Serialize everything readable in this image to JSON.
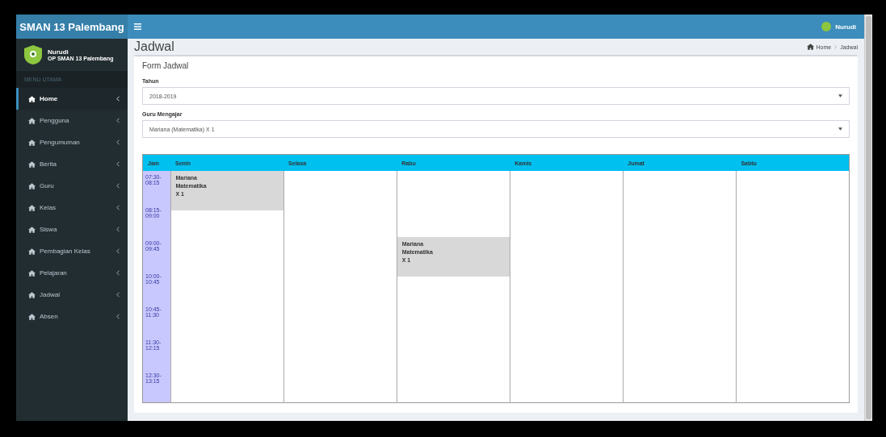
{
  "brand": "SMAN 13 Palembang",
  "header_user": {
    "name": "Nurudi"
  },
  "user_panel": {
    "name": "Nurudi",
    "role": "OP SMAN 13 Palembang"
  },
  "nav_label": "MENU UTAMA",
  "menu": [
    {
      "label": "Home",
      "selected": true
    },
    {
      "label": "Pengguna",
      "selected": false
    },
    {
      "label": "Pengumuman",
      "selected": false
    },
    {
      "label": "Berita",
      "selected": false
    },
    {
      "label": "Guru",
      "selected": false
    },
    {
      "label": "Kelas",
      "selected": false
    },
    {
      "label": "Siswa",
      "selected": false
    },
    {
      "label": "Pembagian Kelas",
      "selected": false
    },
    {
      "label": "Pelajaran",
      "selected": false
    },
    {
      "label": "Jadwal",
      "selected": false
    },
    {
      "label": "Absen",
      "selected": false
    }
  ],
  "page": {
    "title": "Jadwal",
    "breadcrumb": [
      "Home",
      "Jadwal"
    ]
  },
  "form": {
    "title": "Form Jadwal",
    "fields": [
      {
        "label": "Tahun",
        "value": "2018-2019"
      },
      {
        "label": "Guru Mengajar",
        "value": "Mariana (Matematika) X 1"
      }
    ]
  },
  "schedule": {
    "columns": [
      "Jam",
      "Senin",
      "Selasa",
      "Rabu",
      "Kamis",
      "Jumat",
      "Sabtu"
    ],
    "rows": [
      {
        "cells": [
          {
            "kind": "time",
            "lines": [
              "07:30-",
              "08:15"
            ]
          },
          {
            "kind": "lesson",
            "lines": [
              "Mariana",
              "Matematika",
              "X 1"
            ]
          },
          {
            "kind": "empty"
          },
          {
            "kind": "empty"
          },
          {
            "kind": "empty"
          },
          {
            "kind": "empty"
          },
          {
            "kind": "empty"
          }
        ]
      },
      {
        "cells": [
          {
            "kind": "time",
            "lines": [
              "08:15-",
              "09:00"
            ]
          },
          {
            "kind": "empty"
          },
          {
            "kind": "empty"
          },
          {
            "kind": "empty"
          },
          {
            "kind": "empty"
          },
          {
            "kind": "empty"
          },
          {
            "kind": "empty"
          }
        ]
      },
      {
        "cells": [
          {
            "kind": "time",
            "lines": [
              "09:00-",
              "09:45"
            ]
          },
          {
            "kind": "empty"
          },
          {
            "kind": "empty"
          },
          {
            "kind": "lesson",
            "lines": [
              "Mariana",
              "Matematika",
              "X 1"
            ]
          },
          {
            "kind": "empty"
          },
          {
            "kind": "empty"
          },
          {
            "kind": "empty"
          }
        ]
      },
      {
        "cells": [
          {
            "kind": "time",
            "lines": [
              "10:00-",
              "10:45"
            ]
          },
          {
            "kind": "empty"
          },
          {
            "kind": "empty"
          },
          {
            "kind": "empty"
          },
          {
            "kind": "empty"
          },
          {
            "kind": "empty"
          },
          {
            "kind": "empty"
          }
        ]
      },
      {
        "cells": [
          {
            "kind": "time",
            "lines": [
              "10:45-",
              "11:30"
            ]
          },
          {
            "kind": "empty"
          },
          {
            "kind": "empty"
          },
          {
            "kind": "empty"
          },
          {
            "kind": "empty"
          },
          {
            "kind": "empty"
          },
          {
            "kind": "empty"
          }
        ]
      },
      {
        "cells": [
          {
            "kind": "time",
            "lines": [
              "11:30-",
              "12:15"
            ]
          },
          {
            "kind": "empty"
          },
          {
            "kind": "empty"
          },
          {
            "kind": "empty"
          },
          {
            "kind": "empty"
          },
          {
            "kind": "empty"
          },
          {
            "kind": "empty"
          }
        ]
      },
      {
        "cells": [
          {
            "kind": "time",
            "lines": [
              "12:30-",
              "13:15"
            ]
          },
          {
            "kind": "empty"
          },
          {
            "kind": "empty"
          },
          {
            "kind": "empty"
          },
          {
            "kind": "empty"
          },
          {
            "kind": "empty"
          },
          {
            "kind": "empty"
          }
        ]
      }
    ]
  }
}
